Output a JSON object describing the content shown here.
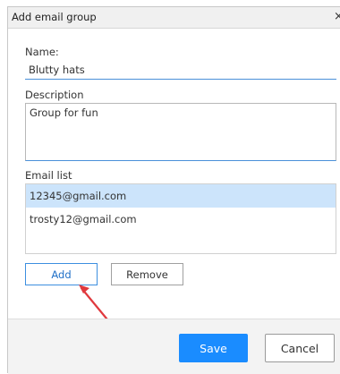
{
  "dialog": {
    "title": "Add email group",
    "close_symbol": "×"
  },
  "name": {
    "label": "Name:",
    "value": "Blutty hats"
  },
  "description": {
    "label": "Description",
    "value": "Group for fun"
  },
  "email_list": {
    "label": "Email list",
    "items": [
      {
        "email": "12345@gmail.com",
        "selected": true
      },
      {
        "email": "trosty12@gmail.com",
        "selected": false
      }
    ]
  },
  "actions": {
    "add_label": "Add",
    "remove_label": "Remove"
  },
  "footer": {
    "save_label": "Save",
    "cancel_label": "Cancel"
  },
  "colors": {
    "accent": "#1a8cff",
    "selection": "#cce4fb",
    "annotation_arrow": "#e0393e"
  },
  "annotation": {
    "arrow_icon": "red-arrow-pointing-to-add-button"
  }
}
